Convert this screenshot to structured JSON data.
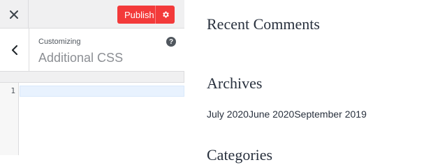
{
  "topbar": {
    "close_icon": "close-icon",
    "publish_label": "Publish",
    "publish_gear_icon": "gear-icon",
    "publish_color": "#f33a3a"
  },
  "section": {
    "back_icon": "chevron-left-icon",
    "crumb": "Customizing",
    "title": "Additional CSS",
    "help_icon": "help-icon",
    "help_glyph": "?"
  },
  "editor": {
    "line_number": "1"
  },
  "preview": {
    "recent_comments_title": "Recent Comments",
    "archives_title": "Archives",
    "archives": [
      "July 2020",
      "June 2020",
      "September 2019"
    ],
    "categories_title": "Categories"
  }
}
